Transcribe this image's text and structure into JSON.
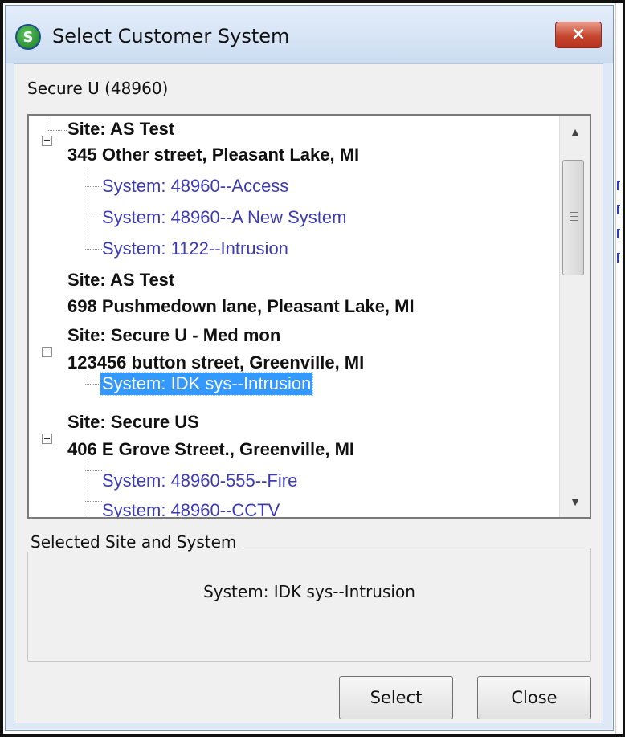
{
  "window": {
    "title": "Select Customer System",
    "app_icon_label": "S",
    "close_label": "×"
  },
  "customer": {
    "label": "Secure U (48960)"
  },
  "tree": {
    "sites": [
      {
        "name": "Site: AS Test",
        "address": "345 Other street, Pleasant Lake, MI",
        "systems": [
          "System: 48960--Access",
          "System: 48960--A New System",
          "System: 1122--Intrusion"
        ]
      },
      {
        "name": "Site: AS Test",
        "address": "698 Pushmedown lane, Pleasant Lake, MI",
        "systems": []
      },
      {
        "name": "Site: Secure U - Med mon",
        "address": "123456 button street, Greenville, MI",
        "systems": [
          "System: IDK sys--Intrusion"
        ]
      },
      {
        "name": "Site: Secure US",
        "address": "406 E Grove Street., Greenville, MI",
        "systems": [
          "System: 48960-555--Fire",
          "System: 48960--CCTV"
        ]
      }
    ],
    "selected_system": "System: IDK sys--Intrusion"
  },
  "selected_panel": {
    "legend": "Selected Site and System",
    "value": "System: IDK sys--Intrusion"
  },
  "buttons": {
    "select": "Select",
    "close": "Close"
  },
  "icons": {
    "app": "green-s-logo-icon",
    "close": "close-icon",
    "collapse": "minus-icon",
    "scroll_up": "arrow-up-icon",
    "scroll_down": "arrow-down-icon",
    "scroll_grip": "grip-lines-icon"
  },
  "colors": {
    "selection_background": "#3399ff",
    "system_text": "#3d3bb2",
    "close_button": "#c5462e"
  }
}
